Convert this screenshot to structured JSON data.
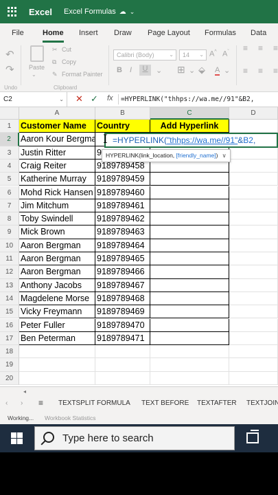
{
  "titlebar": {
    "app_name": "Excel",
    "doc_name": "Excel Formulas",
    "accent": "#217346"
  },
  "ribbon_tabs": [
    "File",
    "Home",
    "Insert",
    "Draw",
    "Page Layout",
    "Formulas",
    "Data"
  ],
  "active_tab": "Home",
  "ribbon": {
    "paste_label": "Paste",
    "cut_label": "Cut",
    "copy_label": "Copy",
    "format_painter_label": "Format Painter",
    "undo_group": "Undo",
    "clipboard_group": "Clipboard",
    "font_name": "Calibri (Body)",
    "font_size": "14"
  },
  "formula_bar": {
    "name_box": "C2",
    "formula": "=HYPERLINK(\"thhps://wa.me//91\"&B2,"
  },
  "columns": [
    "A",
    "B",
    "C",
    "D"
  ],
  "selected_column": "C",
  "selected_row": "2",
  "row_numbers": [
    "1",
    "2",
    "3",
    "4",
    "5",
    "6",
    "7",
    "8",
    "9",
    "10",
    "11",
    "12",
    "13",
    "14",
    "15",
    "16",
    "17",
    "18",
    "19",
    "20"
  ],
  "headers": [
    "Customer Name",
    "Country",
    "Add Hyperlink"
  ],
  "rows": [
    {
      "name": "Aaron Kour Bergman",
      "country": ""
    },
    {
      "name": "Justin Ritter",
      "country": "9"
    },
    {
      "name": "Craig Reiter",
      "country": "9189789458"
    },
    {
      "name": "Katherine Murray",
      "country": "9189789459"
    },
    {
      "name": "Mohd Rick Hansen",
      "country": "9189789460"
    },
    {
      "name": "Jim Mitchum",
      "country": "9189789461"
    },
    {
      "name": "Toby Swindell",
      "country": "9189789462"
    },
    {
      "name": "Mick Brown",
      "country": "9189789463"
    },
    {
      "name": "Aaron Bergman",
      "country": "9189789464"
    },
    {
      "name": "Aaron Bergman",
      "country": "9189789465"
    },
    {
      "name": "Aaron Bergman",
      "country": "9189789466"
    },
    {
      "name": "Anthony Jacobs",
      "country": "9189789467"
    },
    {
      "name": "Magdelene Morse",
      "country": "9189789468"
    },
    {
      "name": "Vicky Freymann",
      "country": "9189789469"
    },
    {
      "name": "Peter Fuller",
      "country": "9189789470"
    },
    {
      "name": "Ben Peterman",
      "country": "9189789471"
    }
  ],
  "edit_cell": {
    "prefix": "=HYPERLINK(",
    "string": "\"thhps://wa.me//91\"",
    "amp": "&",
    "ref": "B2",
    "suffix": ","
  },
  "tooltip": {
    "func": "HYPERLINK(link_location, ",
    "optional_arg": "[friendly_name]",
    "close": ")",
    "chevron": "∨"
  },
  "sheet_tabs": [
    "TEXTSPLIT FORMULA",
    "TEXT BEFORE",
    "TEXTAFTER",
    "TEXTJOIN"
  ],
  "status": {
    "working": "Working...",
    "stats": "Workbook Statistics"
  },
  "taskbar": {
    "search_placeholder": "Type here to search"
  }
}
